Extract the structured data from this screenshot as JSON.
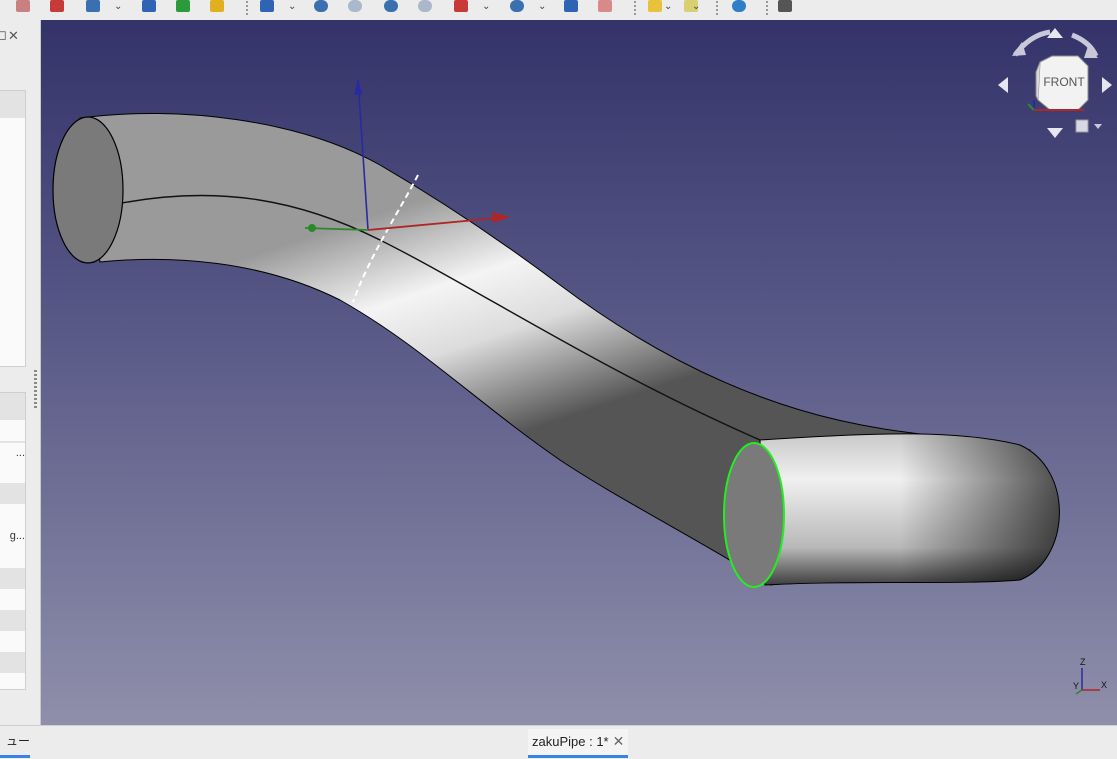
{
  "left_panel": {
    "close_glyph": "✕",
    "rows": [
      "",
      "",
      "",
      "",
      "...",
      "",
      "",
      "g...",
      "",
      "",
      "",
      "",
      ""
    ],
    "view_tab_label": "ュー"
  },
  "navigation_cube": {
    "face_label": "FRONT"
  },
  "mini_axes": {
    "z": "Z",
    "y": "Y",
    "x": "X"
  },
  "document_tab": {
    "label": "zakuPipe : 1*",
    "close_glyph": "✕"
  },
  "colors": {
    "viewport_top": "#33336a",
    "viewport_bottom": "#8f8fab",
    "x_axis": "#b02525",
    "y_axis": "#2a8a2a",
    "z_axis": "#2a2aa0",
    "selection_highlight": "#22ee22",
    "tab_underline": "#3b82e6"
  }
}
